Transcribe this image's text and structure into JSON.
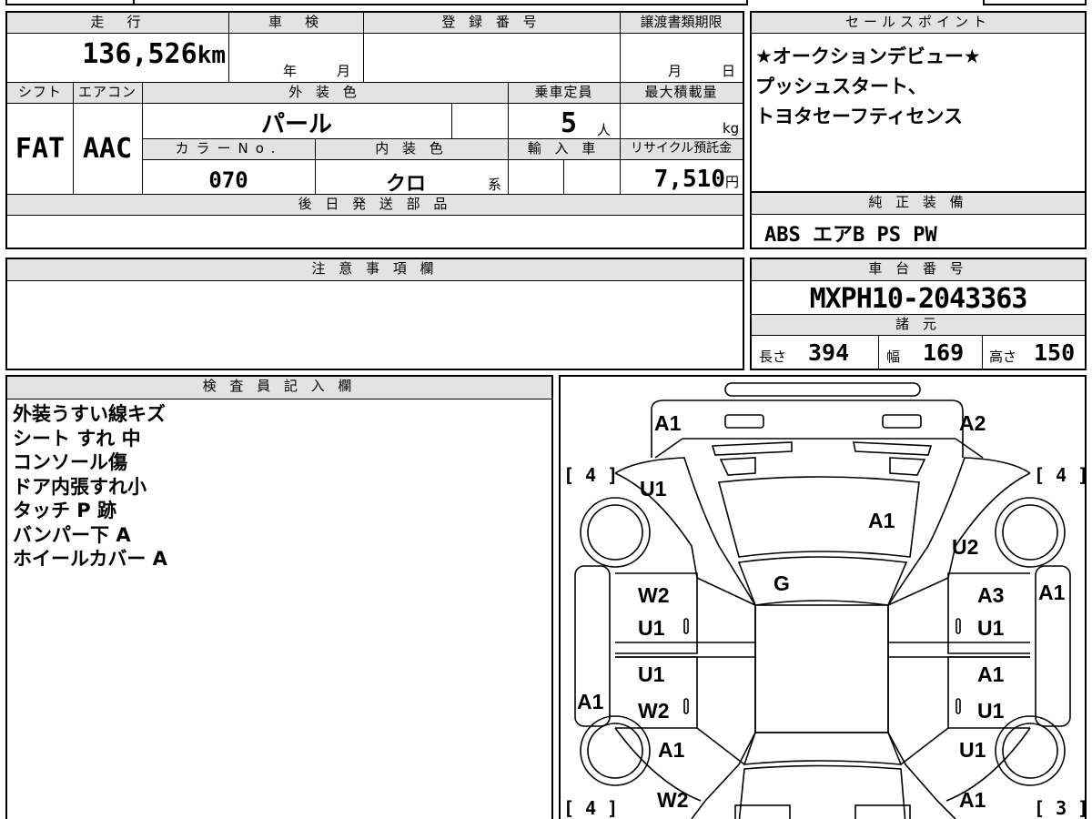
{
  "main": {
    "mileage_header": "走　行",
    "mileage": "136,526",
    "mileage_unit": "km",
    "inspection_header": "車　検",
    "inspection_year": "年",
    "inspection_month": "月",
    "registration_header": "登 録 番 号",
    "transfer_header": "譲渡書類期限",
    "transfer_month": "月",
    "transfer_day": "日",
    "shift_header": "シフト",
    "aircon_header": "エアコン",
    "exterior_color_header": "外 装 色",
    "capacity_header": "乗車定員",
    "max_load_header": "最大積載量",
    "shift": "FAT",
    "aircon": "AAC",
    "exterior_color": "パール",
    "capacity": "5",
    "capacity_unit": "人",
    "max_load_unit": "kg",
    "color_no_header": "カラーNo.",
    "interior_color_header": "内 装 色",
    "import_header": "輸 入 車",
    "recycle_header": "リサイクル預託金",
    "color_no": "070",
    "interior_color": "クロ",
    "interior_color_suffix": "系",
    "recycle_fee": "7,510",
    "recycle_unit": "円",
    "parts_header": "後 日 発 送 部 品"
  },
  "sales": {
    "header": "セールスポイント",
    "lines": [
      "★オークションデビュー★",
      "プッシュスタート、",
      "トヨタセーフティセンス"
    ]
  },
  "equipment": {
    "header": "純 正 装 備",
    "value": "ABS エアB PS PW"
  },
  "notes": {
    "header": "注 意 事 項 欄"
  },
  "chassis": {
    "header": "車 台 番 号",
    "value": "MXPH10-2043363",
    "specs_header": "諸 元",
    "length_label": "長さ",
    "length": "394",
    "width_label": "幅",
    "width": "169",
    "height_label": "高さ",
    "height": "150"
  },
  "inspector": {
    "header": "検 査 員 記 入 欄",
    "lines": [
      "外装うすい線キズ",
      "シート すれ 中",
      "コンソール傷",
      "ドア内張すれ小",
      "タッチ P 跡",
      "バンパー下 A",
      "ホイールカバー A"
    ]
  },
  "diagram": {
    "labels": {
      "front_left_corner": "A1",
      "front_right_corner": "A2",
      "tire_fl": "[ 4 ]",
      "tire_fr": "[ 4 ]",
      "tire_rl": "[ 4 ]",
      "tire_rr": "[ 3 ]",
      "fender_left": "U1",
      "hood": "A1",
      "fender_right": "U2",
      "windshield": "G",
      "front_door_left_top": "W2",
      "front_door_left_bottom": "U1",
      "front_door_right_top": "A3",
      "front_door_right_bottom": "U1",
      "rocker_right": "A1",
      "rear_door_left_top": "U1",
      "rear_door_left_bottom": "W2",
      "rocker_left": "A1",
      "rear_door_right_top": "A1",
      "rear_door_right_bottom": "U1",
      "quarter_left": "A1",
      "quarter_right": "U1",
      "rear_left": "W2",
      "rear_right": "A1"
    }
  }
}
